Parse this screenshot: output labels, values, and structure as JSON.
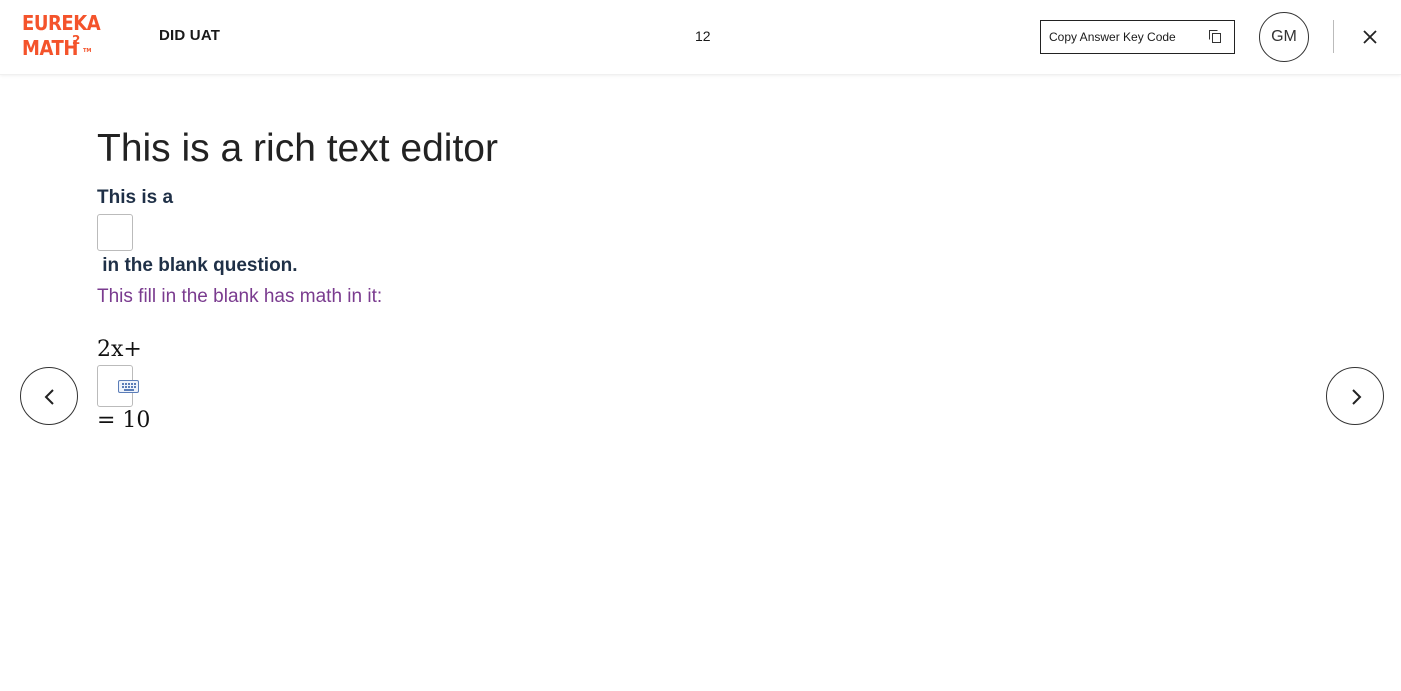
{
  "header": {
    "logo_line1": "EUREKA",
    "logo_line2": "MATH",
    "logo_superscript": "2",
    "logo_tm": "TM",
    "course_title": "DID UAT",
    "page_number": "12",
    "copy_button_label": "Copy Answer Key Code",
    "avatar_initials": "GM"
  },
  "content": {
    "title": "This is a rich text editor",
    "fill_blank_before": "This is a",
    "fill_blank_after": " in the blank question.",
    "math_intro": "This fill in the blank has math in it:",
    "math_before": "2x+",
    "math_after": "= 10"
  },
  "colors": {
    "brand": "#f4532b",
    "bold_text": "#1f3047",
    "purple_text": "#7a3b8f"
  },
  "icons": {
    "copy": "copy-icon",
    "close": "close-icon",
    "prev": "chevron-left-icon",
    "next": "chevron-right-icon",
    "keyboard": "keyboard-icon"
  }
}
